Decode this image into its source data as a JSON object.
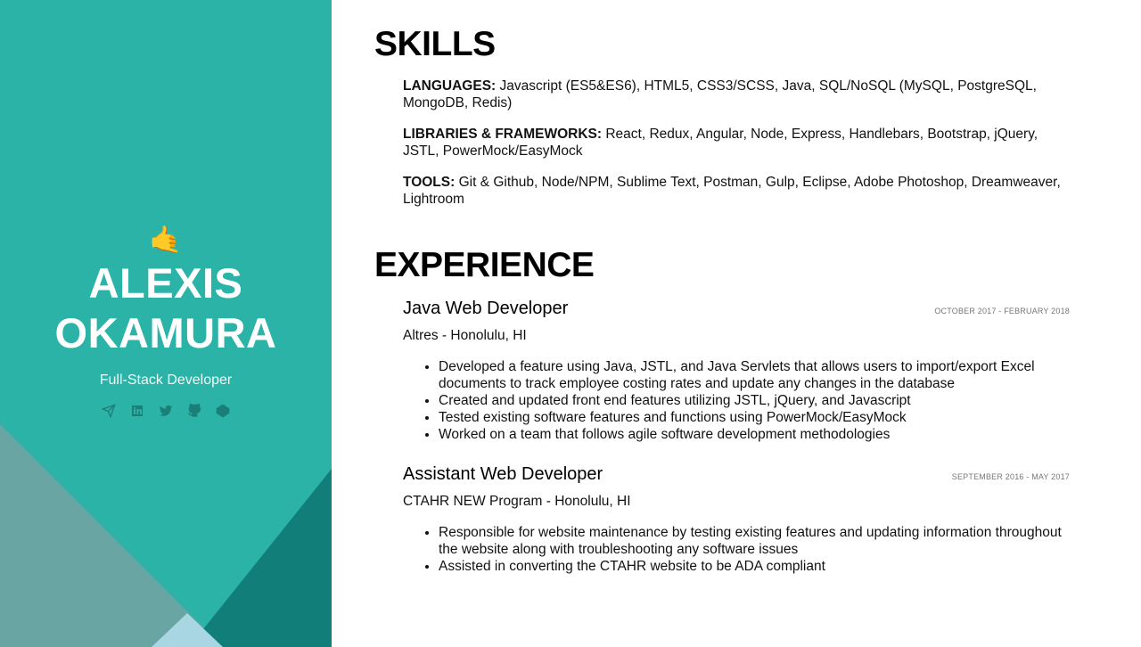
{
  "profile": {
    "emoji": "🤙",
    "first_name": "ALEXIS",
    "last_name": "OKAMURA",
    "role": "Full-Stack Developer",
    "social_icons": [
      "telegram-icon",
      "linkedin-icon",
      "twitter-icon",
      "github-icon",
      "codepen-icon"
    ]
  },
  "colors": {
    "sidebar_bg": "#2bb3a7",
    "sidebar_dark": "#127e79",
    "sidebar_gray": "#68a5a3",
    "sidebar_light": "#a9d6e3"
  },
  "skills": {
    "title": "SKILLS",
    "items": [
      {
        "label": "LANGUAGES:",
        "text": " Javascript (ES5&ES6), HTML5, CSS3/SCSS, Java, SQL/NoSQL (MySQL, PostgreSQL, MongoDB, Redis)"
      },
      {
        "label": "LIBRARIES & FRAMEWORKS:",
        "text": " React, Redux, Angular, Node, Express, Handlebars, Bootstrap, jQuery, JSTL, PowerMock/EasyMock"
      },
      {
        "label": "TOOLS:",
        "text": " Git & Github, Node/NPM, Sublime Text, Postman, Gulp, Eclipse, Adobe Photoshop, Dreamweaver, Lightroom"
      }
    ]
  },
  "experience": {
    "title": "EXPERIENCE",
    "jobs": [
      {
        "title": "Java Web Developer",
        "date": "OCTOBER 2017 - FEBRUARY 2018",
        "company": "Altres - Honolulu, HI",
        "bullets": [
          "Developed a feature using Java, JSTL, and Java Servlets that allows users to import/export Excel documents to track employee costing rates and update any changes in the database",
          "Created and updated front end features utilizing JSTL, jQuery, and Javascript",
          "Tested existing software features and functions using PowerMock/EasyMock",
          "Worked on a team that follows agile software development methodologies"
        ]
      },
      {
        "title": "Assistant Web Developer",
        "date": "SEPTEMBER 2016 - MAY 2017",
        "company": "CTAHR NEW Program - Honolulu, HI",
        "bullets": [
          "Responsible for website maintenance by testing existing features and updating information throughout the website along with troubleshooting any software issues",
          "Assisted in converting the CTAHR website to be ADA compliant"
        ]
      }
    ]
  }
}
